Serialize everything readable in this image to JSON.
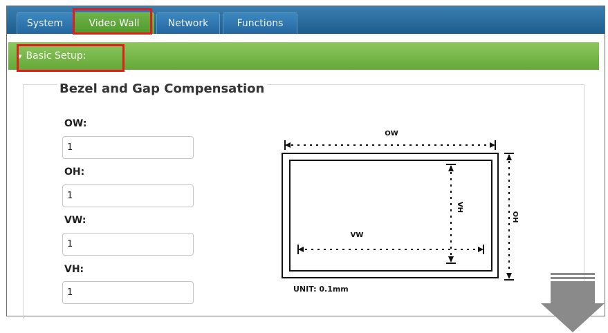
{
  "tabs": [
    {
      "label": "System"
    },
    {
      "label": "Video Wall"
    },
    {
      "label": "Network"
    },
    {
      "label": "Functions"
    }
  ],
  "section": {
    "label": "Basic Setup:",
    "arrow": "▾"
  },
  "panel": {
    "title": "Bezel and Gap Compensation"
  },
  "fields": [
    {
      "label": "OW:",
      "value": "1"
    },
    {
      "label": "OH:",
      "value": "1"
    },
    {
      "label": "VW:",
      "value": "1"
    },
    {
      "label": "VH:",
      "value": "1"
    }
  ],
  "diagram": {
    "ow": "OW",
    "oh": "OH",
    "vw": "VW",
    "vh": "VH",
    "unit": "UNIT: 0.1mm"
  },
  "colors": {
    "highlight": "#e01c1c",
    "tab_active": "#5aa535",
    "tab_bar": "#2467a0",
    "section_bar": "#7cba4d"
  }
}
